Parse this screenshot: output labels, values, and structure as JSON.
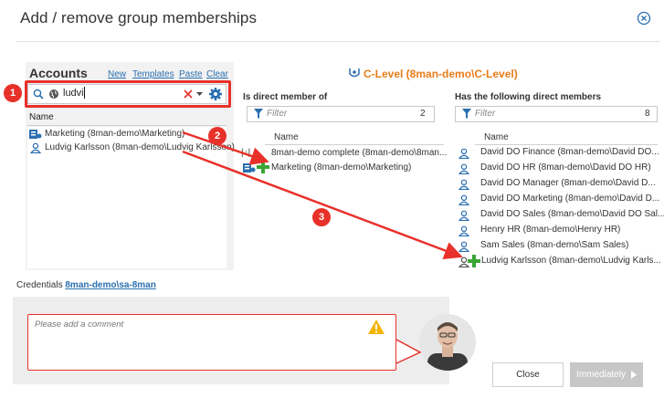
{
  "dialog": {
    "title": "Add / remove group memberships"
  },
  "accounts": {
    "title": "Accounts",
    "links": [
      "New",
      "Templates",
      "Paste",
      "Clear"
    ],
    "search_value": "ludvi",
    "column_name": "Name",
    "items": [
      "Marketing (8man-demo\\Marketing)",
      "Ludvig Karlsson (8man-demo\\Ludvig Karlsson)"
    ]
  },
  "group": {
    "title": "C-Level (8man-demo\\C-Level)"
  },
  "member_of": {
    "title": "Is direct member of",
    "filter_placeholder": "Filter",
    "count": "2",
    "column_name": "Name",
    "items": [
      "8man-demo complete (8man-demo\\8man...",
      "Marketing (8man-demo\\Marketing)"
    ]
  },
  "members": {
    "title": "Has the following direct members",
    "filter_placeholder": "Filter",
    "count": "8",
    "column_name": "Name",
    "items": [
      "David DO Finance (8man-demo\\David DO...",
      "David DO HR (8man-demo\\David DO HR)",
      "David DO Manager (8man-demo\\David D...",
      "David DO Marketing (8man-demo\\David D...",
      "David DO Sales (8man-demo\\David DO Sal...",
      "Henry HR (8man-demo\\Henry HR)",
      "Sam Sales (8man-demo\\Sam Sales)",
      "Ludvig Karlsson (8man-demo\\Ludvig Karls..."
    ]
  },
  "credentials": {
    "label": "Credentials",
    "account": "8man-demo\\sa-8man"
  },
  "comment": {
    "placeholder": "Please add a comment"
  },
  "buttons": {
    "close": "Close",
    "immediately": "Immediately"
  },
  "annotations": {
    "one": "1",
    "two": "2",
    "three": "3"
  },
  "colors": {
    "accent_red": "#e8312a",
    "link_blue": "#2a6fb0",
    "group_orange": "#e87c1a",
    "user_icon_blue": "#2a6fb0",
    "add_green": "#3aa637"
  },
  "icons": [
    "close-circle-icon",
    "search-icon",
    "globe-icon",
    "clear-x-icon",
    "dropdown-icon",
    "settings-gear-icon",
    "group-icon",
    "user-icon",
    "add-plus-icon",
    "filter-icon",
    "warning-icon",
    "chevron-right-icon",
    "avatar"
  ]
}
